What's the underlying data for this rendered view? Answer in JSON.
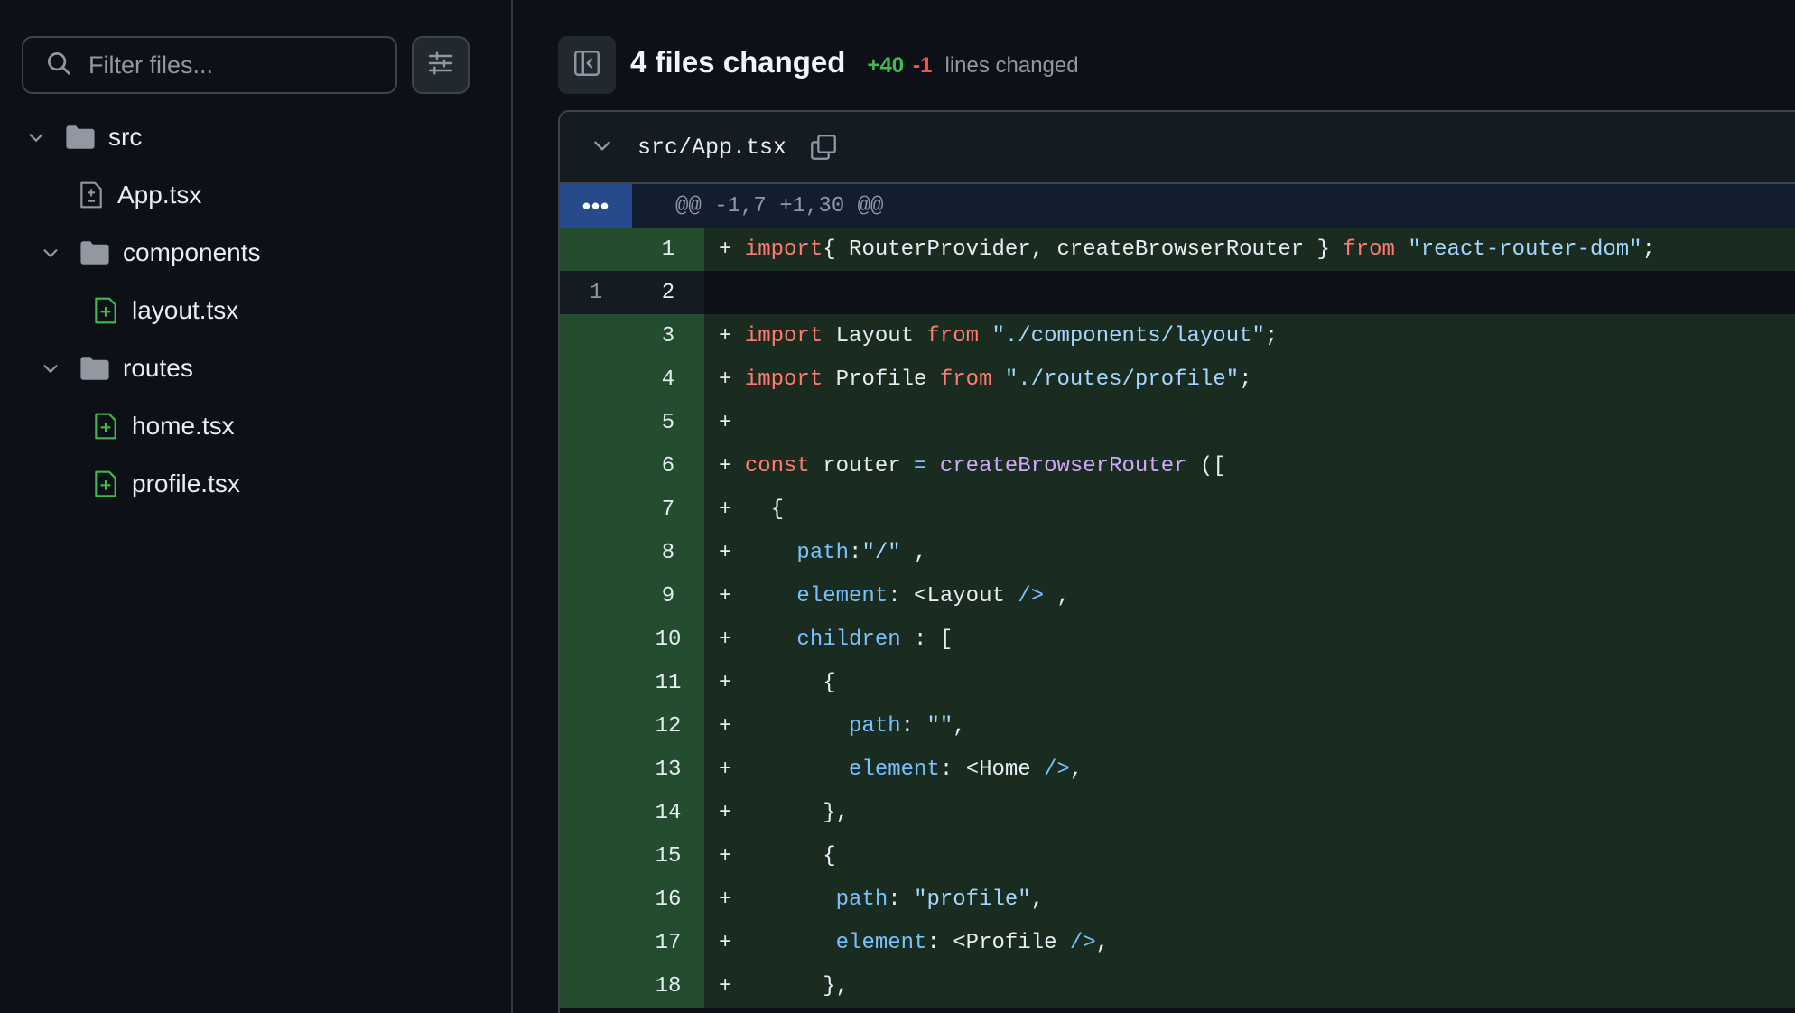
{
  "sidebar": {
    "filter_placeholder": "Filter files...",
    "tree": [
      {
        "type": "folder",
        "label": "src",
        "depth": 0
      },
      {
        "type": "file",
        "label": "App.tsx",
        "depth": 1,
        "status": "modified"
      },
      {
        "type": "folder",
        "label": "components",
        "depth": 1
      },
      {
        "type": "file",
        "label": "layout.tsx",
        "depth": 2,
        "status": "added"
      },
      {
        "type": "folder",
        "label": "routes",
        "depth": 1
      },
      {
        "type": "file",
        "label": "home.tsx",
        "depth": 2,
        "status": "added"
      },
      {
        "type": "file",
        "label": "profile.tsx",
        "depth": 2,
        "status": "added"
      }
    ]
  },
  "header": {
    "title": "4 files changed",
    "additions": "+40",
    "deletions": "-1",
    "lines_label": "lines changed"
  },
  "file": {
    "name": "src/App.tsx",
    "expand_label": "•••",
    "hunk_header": "@@ -1,7 +1,30 @@",
    "lines": [
      {
        "old": "",
        "new": "1",
        "sign": "+",
        "kind": "add",
        "tokens": [
          [
            "kw",
            "import"
          ],
          [
            "",
            "{ RouterProvider, createBrowserRouter } "
          ],
          [
            "kw",
            "from"
          ],
          [
            "",
            " "
          ],
          [
            "str",
            "\"react-router-dom\""
          ],
          [
            "",
            ";"
          ]
        ]
      },
      {
        "old": "1",
        "new": "2",
        "sign": "",
        "kind": "ctx",
        "tokens": []
      },
      {
        "old": "",
        "new": "3",
        "sign": "+",
        "kind": "add",
        "tokens": [
          [
            "kw",
            "import"
          ],
          [
            "",
            " Layout "
          ],
          [
            "kw",
            "from"
          ],
          [
            "",
            " "
          ],
          [
            "str",
            "\"./components/layout\""
          ],
          [
            "",
            ";"
          ]
        ]
      },
      {
        "old": "",
        "new": "4",
        "sign": "+",
        "kind": "add",
        "tokens": [
          [
            "kw",
            "import"
          ],
          [
            "",
            " Profile "
          ],
          [
            "kw",
            "from"
          ],
          [
            "",
            " "
          ],
          [
            "str",
            "\"./routes/profile\""
          ],
          [
            "",
            ";"
          ]
        ]
      },
      {
        "old": "",
        "new": "5",
        "sign": "+",
        "kind": "add",
        "tokens": []
      },
      {
        "old": "",
        "new": "6",
        "sign": "+",
        "kind": "add",
        "tokens": [
          [
            "kw",
            "const"
          ],
          [
            "",
            " router "
          ],
          [
            "op",
            "="
          ],
          [
            "",
            " "
          ],
          [
            "fn",
            "createBrowserRouter"
          ],
          [
            "",
            " (["
          ]
        ]
      },
      {
        "old": "",
        "new": "7",
        "sign": "+",
        "kind": "add",
        "tokens": [
          [
            "",
            "  {"
          ]
        ]
      },
      {
        "old": "",
        "new": "8",
        "sign": "+",
        "kind": "add",
        "tokens": [
          [
            "",
            "    "
          ],
          [
            "prop",
            "path"
          ],
          [
            "",
            ":"
          ],
          [
            "str",
            "\"/\""
          ],
          [
            "",
            " ,"
          ]
        ]
      },
      {
        "old": "",
        "new": "9",
        "sign": "+",
        "kind": "add",
        "tokens": [
          [
            "",
            "    "
          ],
          [
            "prop",
            "element"
          ],
          [
            "",
            ": <Layout "
          ],
          [
            "op",
            "/>"
          ],
          [
            "",
            " ,"
          ]
        ]
      },
      {
        "old": "",
        "new": "10",
        "sign": "+",
        "kind": "add",
        "tokens": [
          [
            "",
            "    "
          ],
          [
            "prop",
            "children"
          ],
          [
            "",
            " : ["
          ]
        ]
      },
      {
        "old": "",
        "new": "11",
        "sign": "+",
        "kind": "add",
        "tokens": [
          [
            "",
            "      {"
          ]
        ]
      },
      {
        "old": "",
        "new": "12",
        "sign": "+",
        "kind": "add",
        "tokens": [
          [
            "",
            "        "
          ],
          [
            "prop",
            "path"
          ],
          [
            "",
            ": "
          ],
          [
            "str",
            "\"\""
          ],
          [
            "",
            ","
          ]
        ]
      },
      {
        "old": "",
        "new": "13",
        "sign": "+",
        "kind": "add",
        "tokens": [
          [
            "",
            "        "
          ],
          [
            "prop",
            "element"
          ],
          [
            "",
            ": <Home "
          ],
          [
            "op",
            "/>"
          ],
          [
            "",
            ","
          ]
        ]
      },
      {
        "old": "",
        "new": "14",
        "sign": "+",
        "kind": "add",
        "tokens": [
          [
            "",
            "      },"
          ]
        ]
      },
      {
        "old": "",
        "new": "15",
        "sign": "+",
        "kind": "add",
        "tokens": [
          [
            "",
            "      {"
          ]
        ]
      },
      {
        "old": "",
        "new": "16",
        "sign": "+",
        "kind": "add",
        "tokens": [
          [
            "",
            "       "
          ],
          [
            "prop",
            "path"
          ],
          [
            "",
            ": "
          ],
          [
            "str",
            "\"profile\""
          ],
          [
            "",
            ","
          ]
        ]
      },
      {
        "old": "",
        "new": "17",
        "sign": "+",
        "kind": "add",
        "tokens": [
          [
            "",
            "       "
          ],
          [
            "prop",
            "element"
          ],
          [
            "",
            ": <Profile "
          ],
          [
            "op",
            "/>"
          ],
          [
            "",
            ","
          ]
        ]
      },
      {
        "old": "",
        "new": "18",
        "sign": "+",
        "kind": "add",
        "tokens": [
          [
            "",
            "      },"
          ]
        ]
      }
    ]
  },
  "colors": {
    "background": "#0d1117",
    "added_line": "#1a2b20",
    "added_gutter": "#244d2f",
    "hunk_expand": "#264a8c",
    "additions": "#3fb950",
    "deletions": "#f85149",
    "keyword": "#ff7b72",
    "string": "#a5d6ff",
    "property": "#79c0ff",
    "function": "#d2a8ff"
  },
  "icons": {
    "search": "search-icon",
    "filter_settings": "sliders-icon",
    "sidebar_toggle": "sidebar-collapse-icon",
    "collapse_file": "chevron-down-icon",
    "copy_path": "copy-icon",
    "folder": "folder-icon",
    "file_modified": "file-diff-icon",
    "file_added": "file-added-icon"
  }
}
